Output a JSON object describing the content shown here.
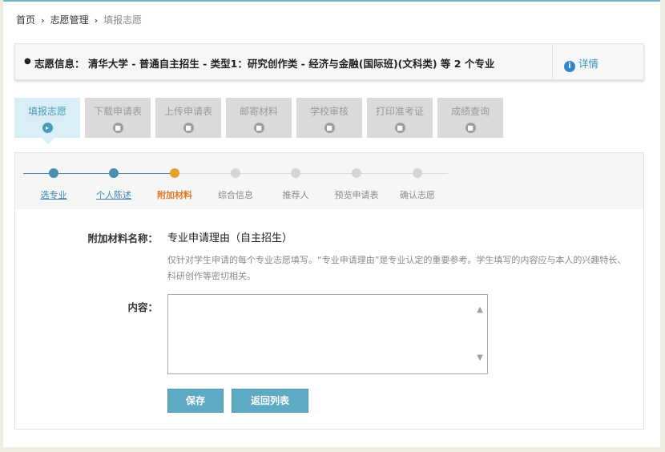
{
  "breadcrumb": {
    "home": "首页",
    "section": "志愿管理",
    "current": "填报志愿"
  },
  "info_bar": {
    "label": "志愿信息： 清华大学 - 普通自主招生 - 类型1：研究创作类 - 经济与金融(国际班)(文科类) 等 2 个专业",
    "detail_icon": "info-icon",
    "detail_label": "详情"
  },
  "tabs": [
    {
      "label": "填报志愿",
      "active": true
    },
    {
      "label": "下载申请表",
      "active": false
    },
    {
      "label": "上传申请表",
      "active": false
    },
    {
      "label": "邮寄材料",
      "active": false
    },
    {
      "label": "学校审核",
      "active": false
    },
    {
      "label": "打印准考证",
      "active": false
    },
    {
      "label": "成绩查询",
      "active": false
    }
  ],
  "steps": [
    {
      "label": "选专业",
      "state": "done"
    },
    {
      "label": "个人陈述",
      "state": "done"
    },
    {
      "label": "附加材料",
      "state": "current"
    },
    {
      "label": "综合信息",
      "state": "pending"
    },
    {
      "label": "推荐人",
      "state": "pending"
    },
    {
      "label": "预览申请表",
      "state": "pending"
    },
    {
      "label": "确认志愿",
      "state": "pending"
    }
  ],
  "form": {
    "material_name_label": "附加材料名称：",
    "material_name_value": "专业申请理由（自主招生）",
    "hint": "仅针对学生申请的每个专业志愿填写。“专业申请理由”是专业认定的重要参考。学生填写的内容应与本人的兴趣特长、科研创作等密切相关。",
    "content_label": "内容：",
    "content_value": ""
  },
  "buttons": {
    "save": "保存",
    "back": "返回列表"
  },
  "colors": {
    "accent": "#5eaac4",
    "step_done": "#4a8fb0",
    "step_current": "#e3a32c",
    "step_pending": "#d6d6d6",
    "link": "#3b8ec2"
  }
}
